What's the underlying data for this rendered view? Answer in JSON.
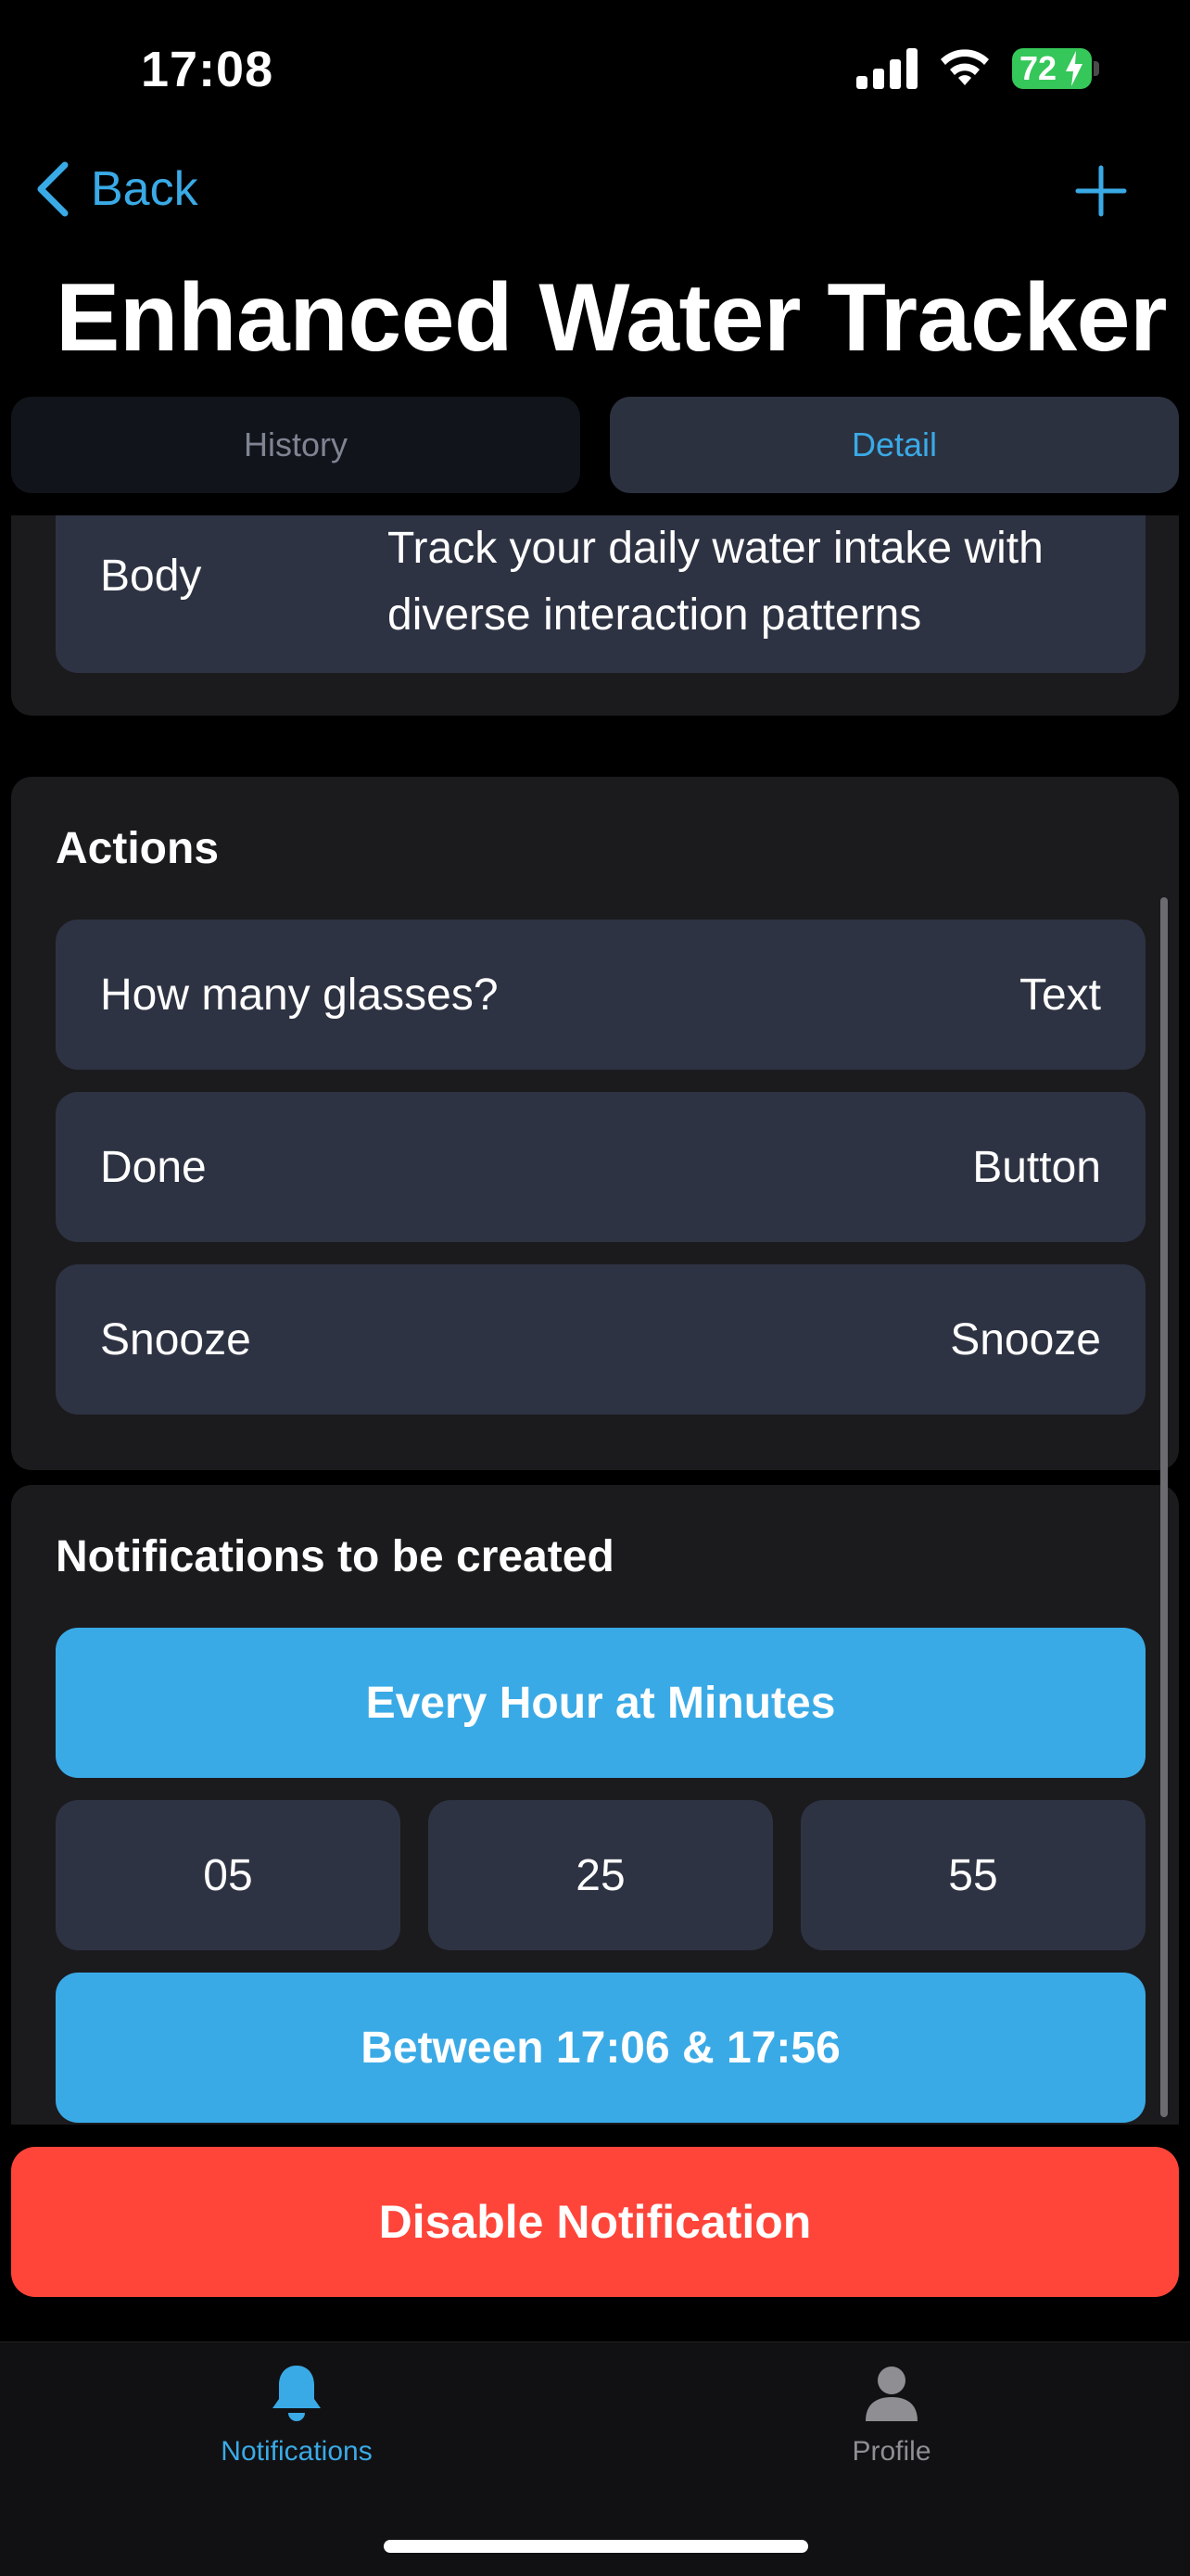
{
  "status_bar": {
    "time": "17:08",
    "battery": "72"
  },
  "nav": {
    "back_label": "Back",
    "title": "Enhanced Water Tracker",
    "back_icon": "chevron-left-icon",
    "add_icon": "plus-icon"
  },
  "tabs": [
    {
      "label": "History",
      "selected": false
    },
    {
      "label": "Detail",
      "selected": true
    }
  ],
  "body_card": {
    "label": "Body",
    "text": "Track your daily water intake with diverse interaction patterns"
  },
  "actions": {
    "title": "Actions",
    "items": [
      {
        "label": "How many glasses?",
        "type": "Text"
      },
      {
        "label": "Done",
        "type": "Button"
      },
      {
        "label": "Snooze",
        "type": "Snooze"
      }
    ]
  },
  "notifications": {
    "title": "Notifications to be created",
    "schedule": "Every Hour at Minutes",
    "minutes": [
      "05",
      "25",
      "55"
    ],
    "window": "Between 17:06 & 17:56"
  },
  "disable_label": "Disable Notification",
  "tabbar": [
    {
      "label": "Notifications",
      "icon": "bell-icon",
      "active": true
    },
    {
      "label": "Profile",
      "icon": "person-icon",
      "active": false
    }
  ],
  "colors": {
    "accent": "#3aaae6",
    "destructive": "#ff453a",
    "card": "#1b1b1e",
    "row": "#2e3343"
  }
}
